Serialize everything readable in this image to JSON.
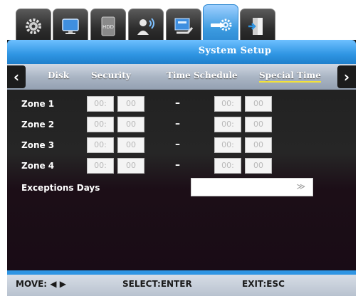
{
  "icon_tabs": [
    {
      "icon": "gear-icon",
      "active": false
    },
    {
      "icon": "monitor-icon",
      "active": false
    },
    {
      "icon": "hdd-icon",
      "label": "HDD",
      "active": false
    },
    {
      "icon": "network-user-icon",
      "active": false
    },
    {
      "icon": "record-schedule-icon",
      "active": false
    },
    {
      "icon": "system-setup-icon",
      "active": true
    },
    {
      "icon": "exit-door-icon",
      "active": false
    }
  ],
  "window": {
    "title": "System Setup"
  },
  "subtabs": [
    {
      "label": "Disk",
      "active": false
    },
    {
      "label": "Security",
      "active": false
    },
    {
      "label": "Time Schedule",
      "active": false
    },
    {
      "label": "Special Time",
      "active": true
    }
  ],
  "zones": [
    {
      "label": "Zone 1",
      "start_hour": "00:",
      "start_min": "00",
      "end_hour": "00:",
      "end_min": "00"
    },
    {
      "label": "Zone 2",
      "start_hour": "00:",
      "start_min": "00",
      "end_hour": "00:",
      "end_min": "00"
    },
    {
      "label": "Zone 3",
      "start_hour": "00:",
      "start_min": "00",
      "end_hour": "00:",
      "end_min": "00"
    },
    {
      "label": "Zone 4",
      "start_hour": "00:",
      "start_min": "00",
      "end_hour": "00:",
      "end_min": "00"
    }
  ],
  "range_separator": "–",
  "exceptions": {
    "label": "Exceptions Days",
    "value": "",
    "arrow": "≫"
  },
  "footer": {
    "move": "MOVE: ◀ ▶",
    "select": "SELECT:ENTER",
    "exit": "EXIT:ESC"
  },
  "colors": {
    "accent": "#2f95e3",
    "active_underline": "#f2e23a",
    "window_bg": "#1a1a1a"
  }
}
